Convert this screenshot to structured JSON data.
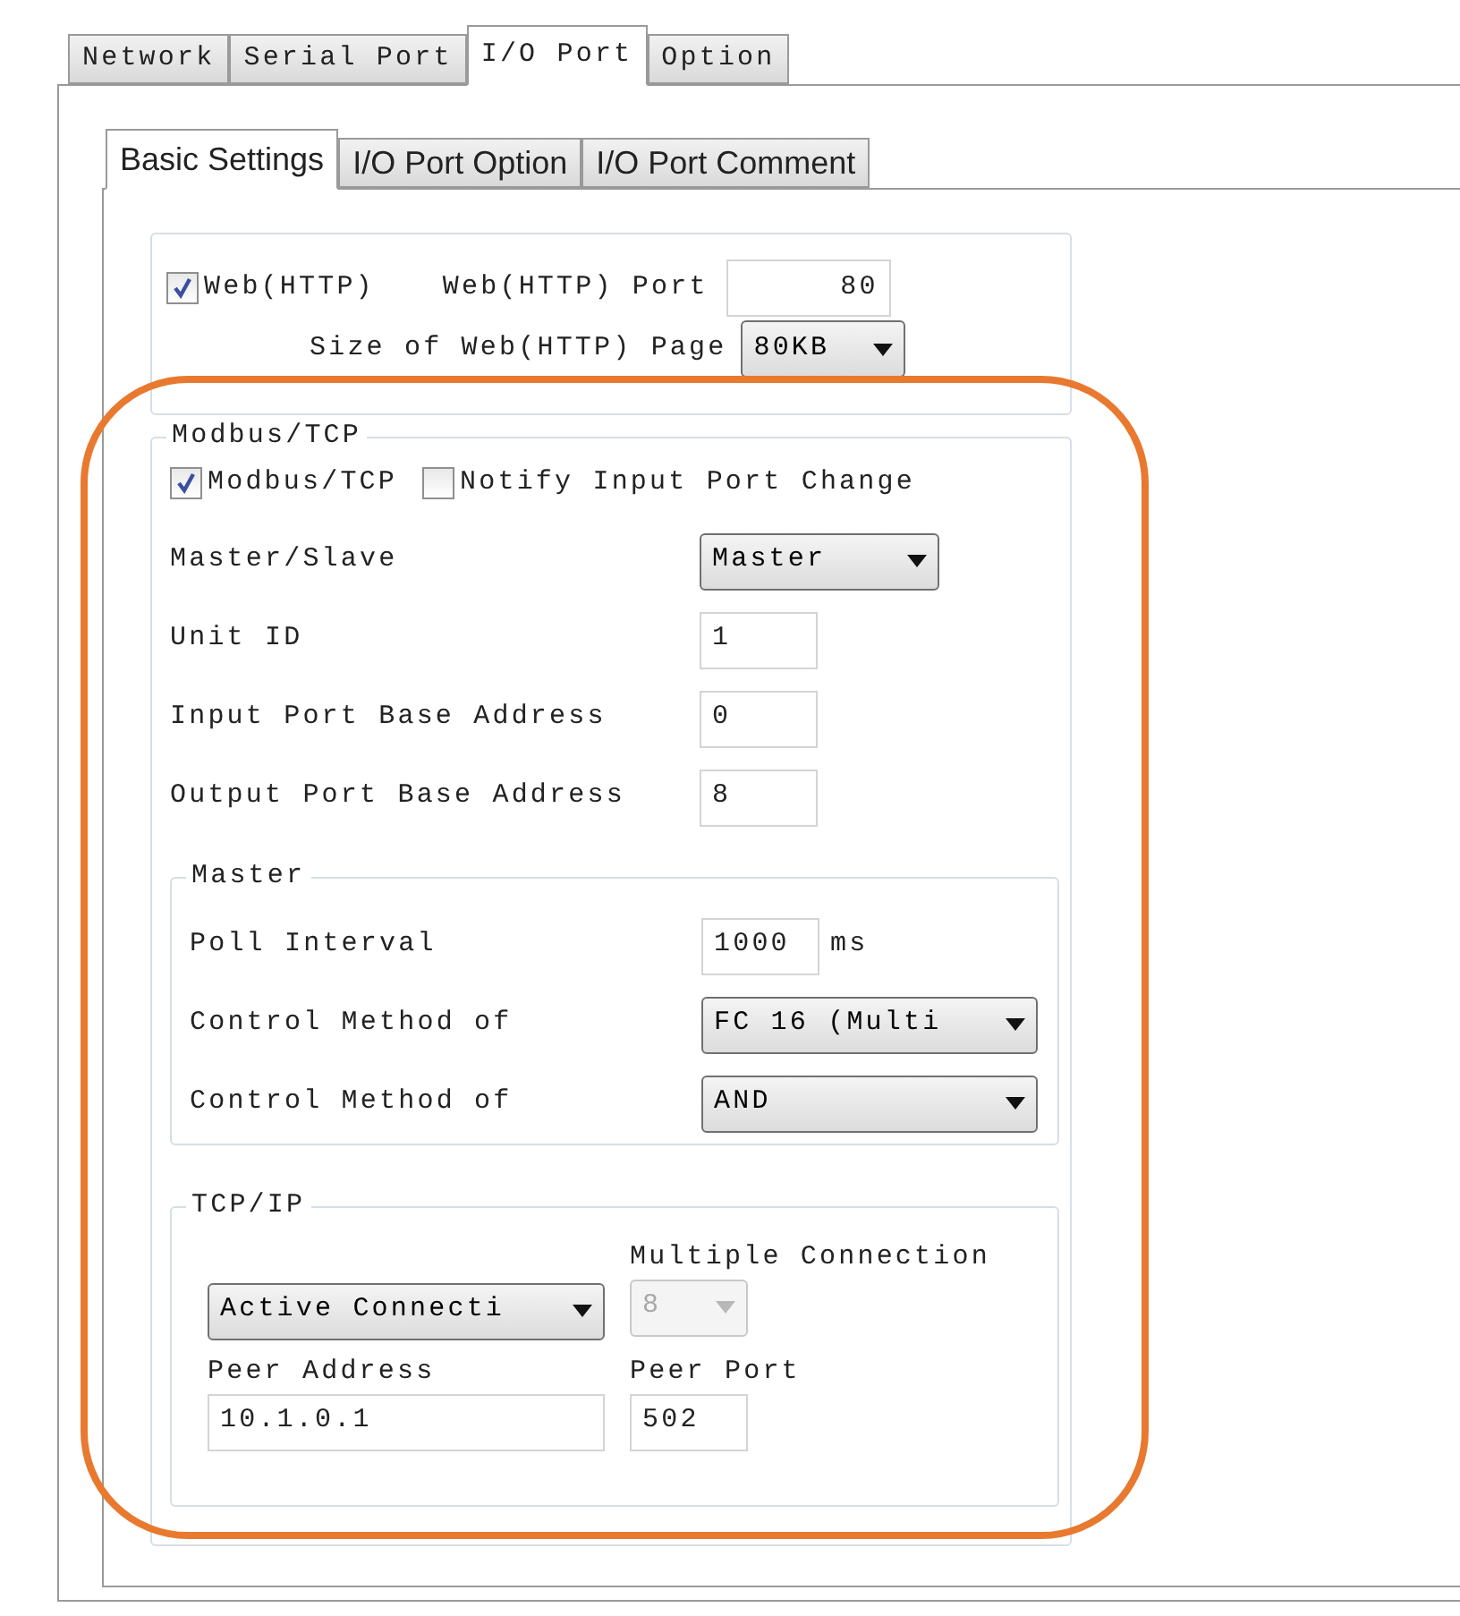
{
  "tabs": [
    {
      "label": "Network",
      "selected": false
    },
    {
      "label": "Serial Port",
      "selected": false
    },
    {
      "label": "I/O Port",
      "selected": true
    },
    {
      "label": "Option",
      "selected": false
    }
  ],
  "subtabs": [
    {
      "label": "Basic Settings",
      "selected": true
    },
    {
      "label": "I/O Port Option",
      "selected": false
    },
    {
      "label": "I/O Port Comment",
      "selected": false
    }
  ],
  "web": {
    "checkbox": {
      "label": "Web(HTTP)",
      "checked": true
    },
    "port_label": "Web(HTTP) Port",
    "port_value": "80",
    "page_size_label": "Size of Web(HTTP) Page",
    "page_size_value": "80KB"
  },
  "modbus": {
    "title": "Modbus/TCP",
    "checkboxes": [
      {
        "label": "Modbus/TCP",
        "checked": true
      },
      {
        "label": "Notify Input Port Change",
        "checked": false
      }
    ],
    "fields": [
      {
        "kind": "select",
        "label": "Master/Slave",
        "value": "Master"
      },
      {
        "kind": "input",
        "label": "Unit ID",
        "value": "1"
      },
      {
        "kind": "input",
        "label": "Input Port Base Address",
        "value": "0"
      },
      {
        "kind": "input",
        "label": "Output Port Base Address",
        "value": "8"
      }
    ]
  },
  "master": {
    "title": "Master",
    "fields": [
      {
        "kind": "input",
        "label": "Poll Interval",
        "value": "1000",
        "unit": "ms"
      },
      {
        "kind": "select",
        "label": "Control Method of",
        "value": "FC 16 (Multi"
      },
      {
        "kind": "select",
        "label": "Control Method of",
        "value": "AND"
      }
    ]
  },
  "tcpip": {
    "title": "TCP/IP",
    "mode": {
      "value": "Active Connecti"
    },
    "multiple_connection": {
      "label": "Multiple Connection",
      "value": "8",
      "disabled": true
    },
    "peer_address": {
      "label": "Peer Address",
      "value": "10.1.0.1"
    },
    "peer_port": {
      "label": "Peer Port",
      "value": "502"
    }
  }
}
